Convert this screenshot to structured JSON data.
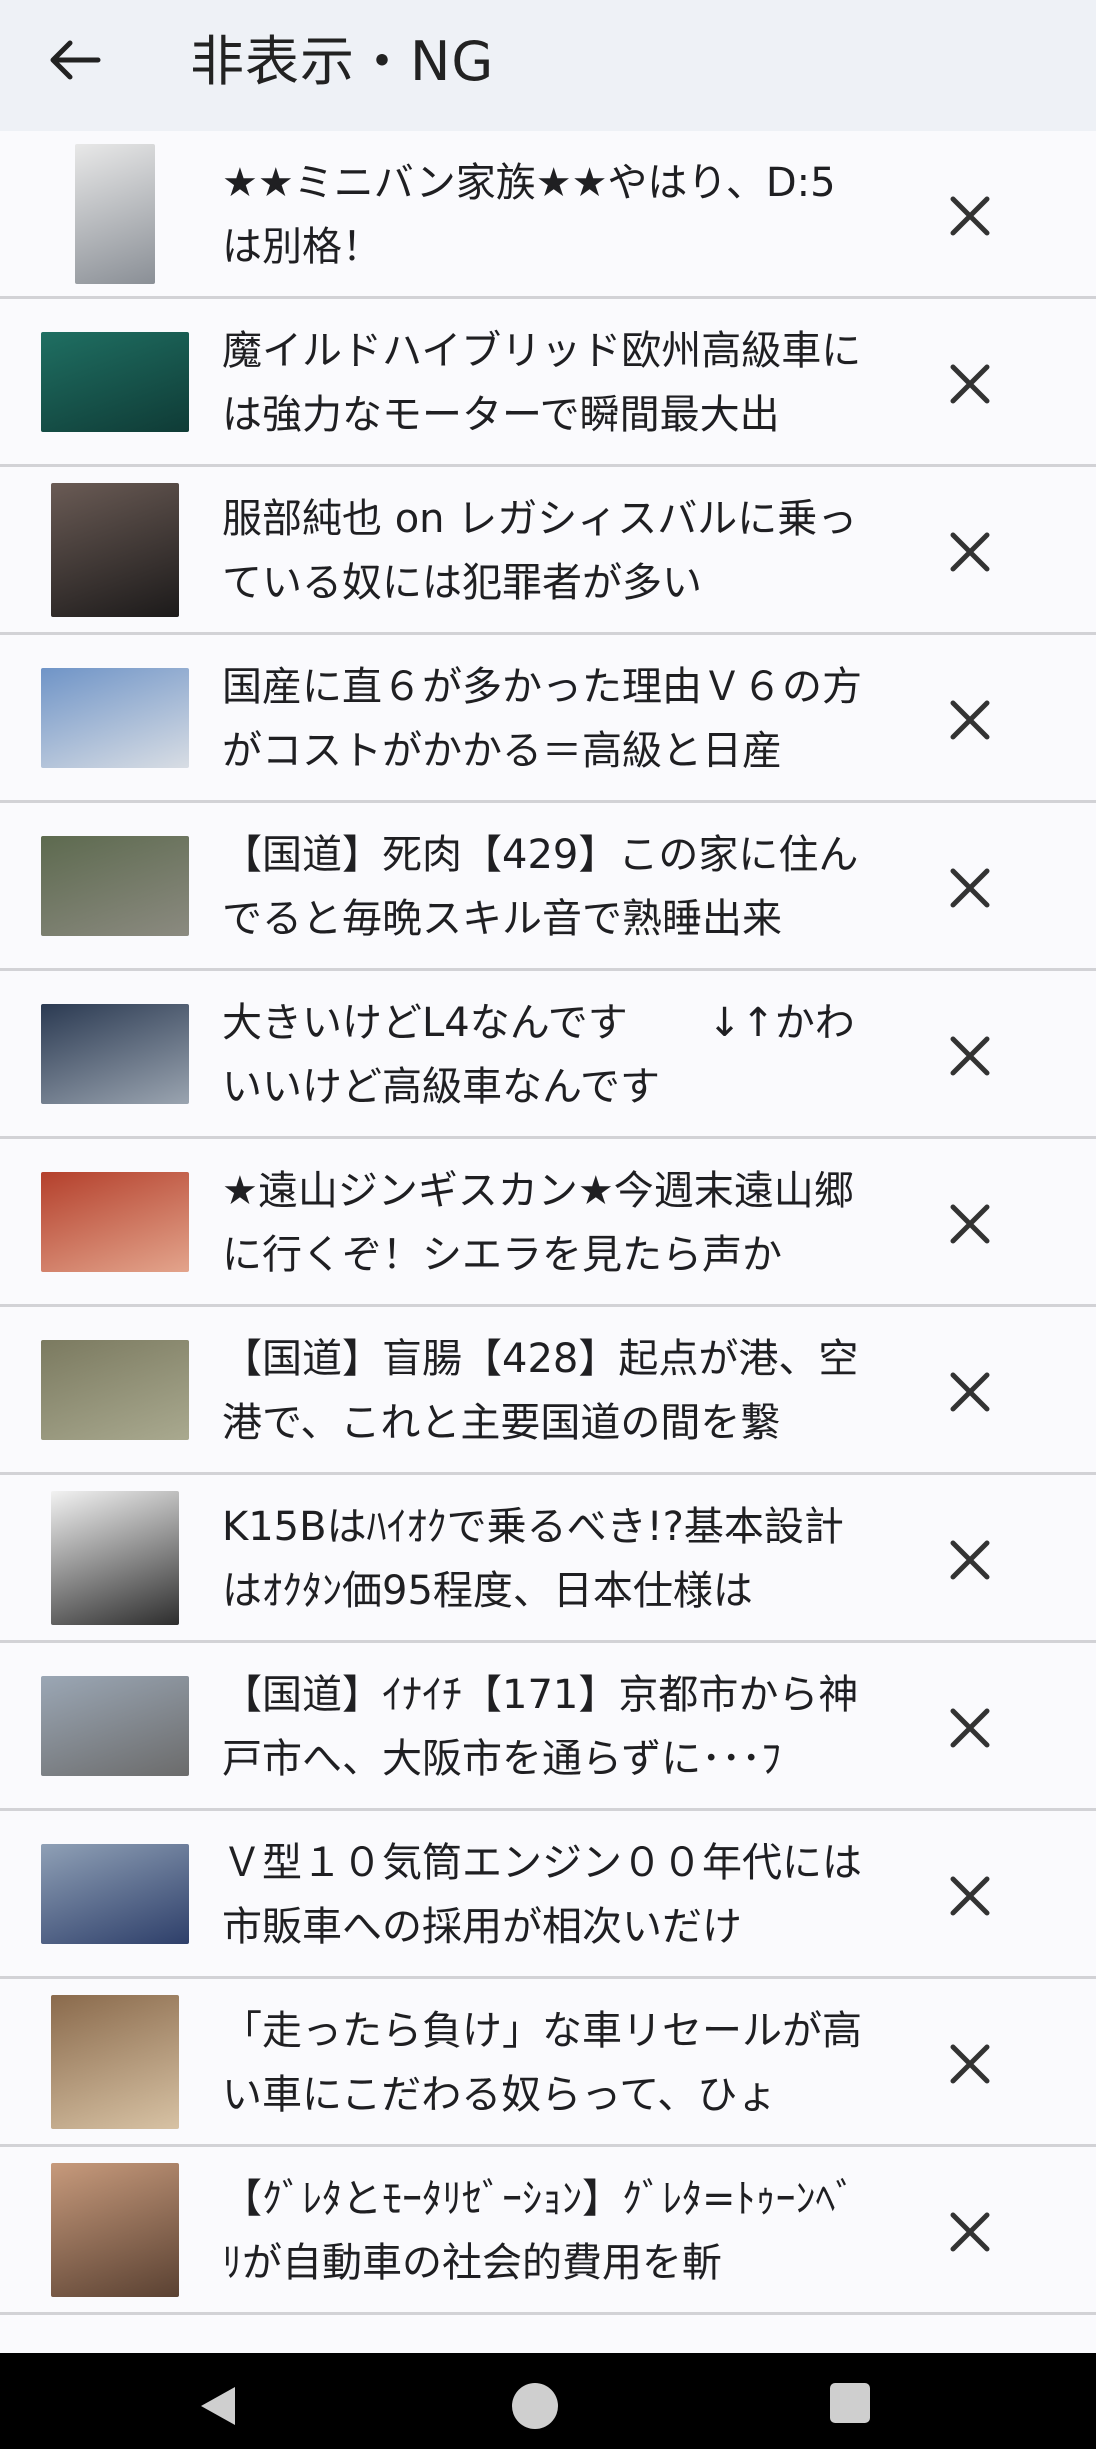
{
  "header": {
    "title": "非表示・NG",
    "back_icon": "arrow-left-icon"
  },
  "items": [
    {
      "title": "★★ミニバン家族★★やはり、D:5は別格！",
      "thumb": "manga-panels",
      "colors": [
        "#e8e8e8",
        "#8a8f96"
      ]
    },
    {
      "title": "魔イルドハイブリッド欧州高級車には強力なモーターで瞬間最大出",
      "thumb": "green-sedan",
      "colors": [
        "#1f6f62",
        "#0f3b36"
      ]
    },
    {
      "title": "服部純也 on レガシィスバルに乗っている奴には犯罪者が多い",
      "thumb": "portrait-photo",
      "colors": [
        "#6a5b55",
        "#1c1a1a"
      ]
    },
    {
      "title": "国産に直６が多かった理由Ｖ６の方がコストがかかる＝高級と日産",
      "thumb": "white-car-fuji",
      "colors": [
        "#6f94c7",
        "#d8dde4"
      ]
    },
    {
      "title": "【国道】死肉【429】この家に住んでると毎晩スキル音で熟睡出来",
      "thumb": "aerial-village",
      "colors": [
        "#5d6a4f",
        "#8b8a80"
      ]
    },
    {
      "title": "大きいけどL4なんです　　↓↑かわいいけど高級車なんです",
      "thumb": "silver-luxury-car",
      "colors": [
        "#2b3a52",
        "#9aa4b0"
      ]
    },
    {
      "title": "★遠山ジンギスカン★今週末遠山郷に行くぞ！シエラを見たら声か",
      "thumb": "grilled-meat",
      "colors": [
        "#b4402c",
        "#e3a48c"
      ]
    },
    {
      "title": "【国道】盲腸【428】起点が港、空港で、これと主要国道の間を繋",
      "thumb": "road-tunnel",
      "colors": [
        "#7b7a60",
        "#a9a98f"
      ]
    },
    {
      "title": "K15Bはﾊｲｵｸで乗るべき!?基本設計はｵｸﾀﾝ価95程度、日本仕様は",
      "thumb": "engine-part",
      "colors": [
        "#f2f2f2",
        "#2d2d2d"
      ]
    },
    {
      "title": "【国道】ｲﾅｲﾁ【171】京都市から神戸市へ、大阪市を通らずに･･･ﾌ",
      "thumb": "road-skyline",
      "colors": [
        "#9ba7b5",
        "#6b6b6b"
      ]
    },
    {
      "title": "Ｖ型１０気筒エンジン００年代には市販車への採用が相次いだけ",
      "thumb": "blue-coupe",
      "colors": [
        "#8fa0b6",
        "#2e3f6a"
      ]
    },
    {
      "title": "「走ったら負け」な車リセールが高い車にこだわる奴らって、ひょ",
      "thumb": "person-shirt",
      "colors": [
        "#8a6a4c",
        "#d7c2a4"
      ]
    },
    {
      "title": "【ｸﾞﾚﾀとﾓｰﾀﾘｾﾞｰｼｮﾝ】ｸﾞﾚﾀ=ﾄｩｰﾝﾍﾞﾘが自動車の社会的費用を斬",
      "thumb": "girl-portrait",
      "colors": [
        "#c79a7c",
        "#5a4132"
      ]
    }
  ],
  "close_icon": "close-x-icon",
  "navbar": {
    "back": "nav-back-triangle-icon",
    "home": "nav-home-circle-icon",
    "recent": "nav-recent-square-icon"
  }
}
